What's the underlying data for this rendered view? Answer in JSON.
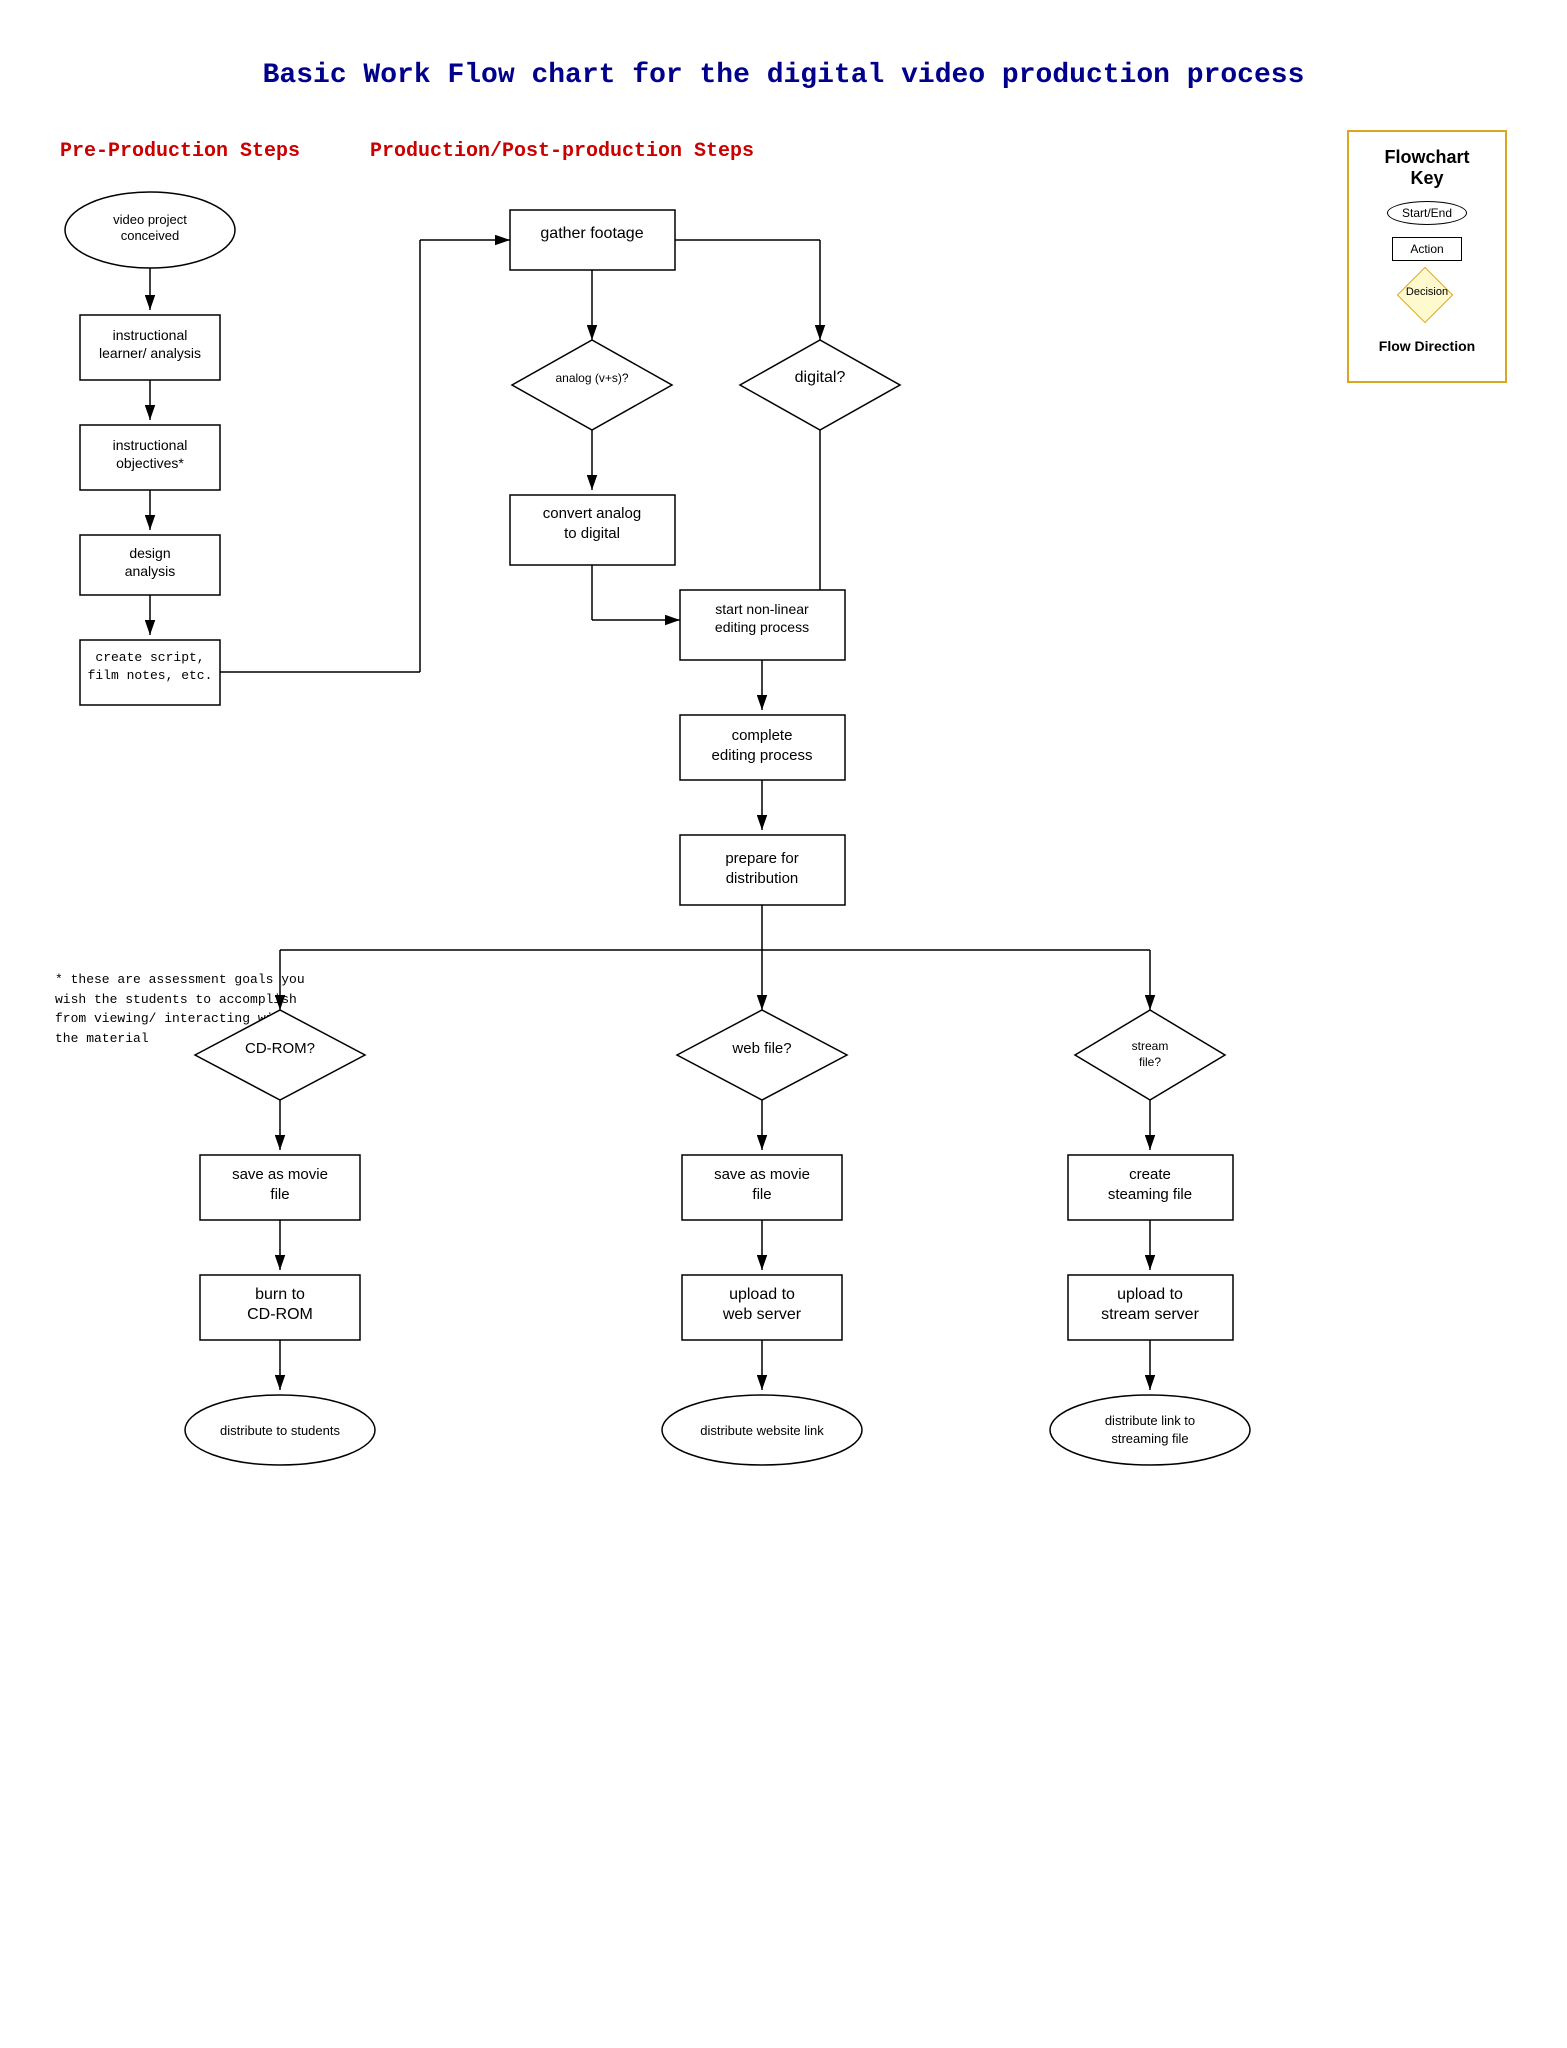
{
  "title": "Basic Work Flow chart for the digital video production process",
  "sections": {
    "pre_production": "Pre-Production Steps",
    "production": "Production/Post-production Steps"
  },
  "flowchart_key": {
    "title": "Flowchart Key",
    "items": [
      {
        "label": "Start/End",
        "type": "oval"
      },
      {
        "label": "Action",
        "type": "rect"
      },
      {
        "label": "Decision",
        "type": "diamond"
      },
      {
        "label": "Flow Direction",
        "type": "arrow"
      }
    ]
  },
  "nodes": {
    "video_project": "video project\nconceived",
    "instructional_learner": "instructional\nlearner/ analysis",
    "instructional_objectives": "instructional\nobjectives*",
    "design_analysis": "design\nanalysis",
    "create_script": "create script,\nfilm notes, etc.",
    "gather_footage": "gather footage",
    "analog_decision": "analog (v+s)?",
    "digital_decision": "digital?",
    "convert_analog": "convert analog\nto digital",
    "start_nonlinear": "start non-linear\nediting process",
    "complete_editing": "complete\nediting process",
    "prepare_distribution": "prepare for\ndistribution",
    "cdrom_decision": "CD-ROM?",
    "web_decision": "web file?",
    "stream_decision": "stream\nfile?",
    "save_movie_cdrom": "save as movie\nfile",
    "save_movie_web": "save as movie\nfile",
    "create_streaming": "create\nsteaming file",
    "burn_cdrom": "burn to\nCD-ROM",
    "upload_web": "upload to\nweb server",
    "upload_stream": "upload to\nstream server",
    "distribute_students": "distribute to students",
    "distribute_website": "distribute website link",
    "distribute_streaming": "distribute link to\nstreaming file"
  },
  "footnote": "* these are assessment goals you wish the\nstudents to accomplish from viewing/ interacting\nwith the material"
}
